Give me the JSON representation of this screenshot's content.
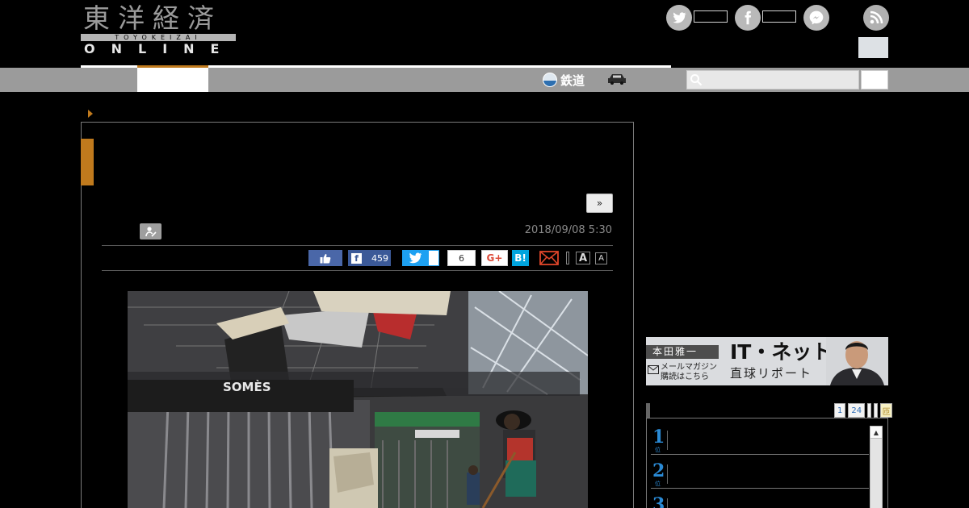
{
  "header": {
    "logo_kanji": "東洋経済",
    "logo_roman": "TOYOKEIZAI",
    "logo_online": "ONLINE",
    "social": [
      {
        "name": "twitter-icon",
        "glyph": "t"
      },
      {
        "name": "facebook-icon",
        "glyph": "f"
      },
      {
        "name": "messenger-icon",
        "glyph": "~"
      }
    ]
  },
  "nav": {
    "rail_label": "鉄道",
    "accent_color": "#c07a1d"
  },
  "article": {
    "next_label": "»",
    "date": "2018/09/08 5:30",
    "share": {
      "facebook_count": "459",
      "line_count": "6",
      "gplus_label": "G+",
      "hatena_label": "B!",
      "font_large": "A",
      "font_small": "A"
    },
    "photo": {
      "store_sign": "SOMÈS"
    }
  },
  "sidebar": {
    "banner": {
      "name": "本田雅一",
      "mag_line1": "メールマガジン",
      "mag_line2": "購読はこちら",
      "title": "IT・ネット",
      "subtitle": "直球リポート"
    },
    "ranking": {
      "tabs": [
        "1",
        "24"
      ],
      "last_tab": "匝",
      "items": [
        {
          "rank": "1",
          "suffix": "位"
        },
        {
          "rank": "2",
          "suffix": "位"
        },
        {
          "rank": "3",
          "suffix": "位"
        }
      ]
    }
  }
}
